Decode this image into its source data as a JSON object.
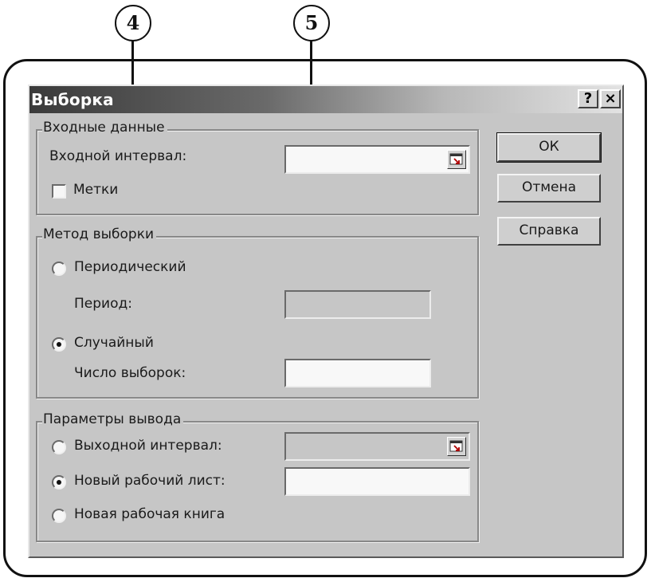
{
  "callouts": {
    "left": "4",
    "right": "5"
  },
  "dialog": {
    "title": "Выборка",
    "help_button": "?",
    "close_button": "×"
  },
  "input_group": {
    "label": "Входные данные",
    "input_range_label": "Входной интервал:",
    "input_range_value": "",
    "labels_checkbox": "Метки",
    "labels_checked": false
  },
  "method_group": {
    "label": "Метод выборки",
    "periodic_label": "Периодический",
    "periodic_selected": false,
    "period_label": "Период:",
    "period_value": "",
    "random_label": "Случайный",
    "random_selected": true,
    "sample_count_label": "Число выборок:",
    "sample_count_value": ""
  },
  "output_group": {
    "label": "Параметры вывода",
    "output_range_label": "Выходной интервал:",
    "output_range_selected": false,
    "output_range_value": "",
    "new_sheet_label": "Новый рабочий лист:",
    "new_sheet_selected": true,
    "new_sheet_value": "",
    "new_book_label": "Новая рабочая книга",
    "new_book_selected": false
  },
  "buttons": {
    "ok": "ОК",
    "cancel": "Отмена",
    "help": "Справка"
  },
  "icons": {
    "ref": "collapse-dialog-icon"
  }
}
